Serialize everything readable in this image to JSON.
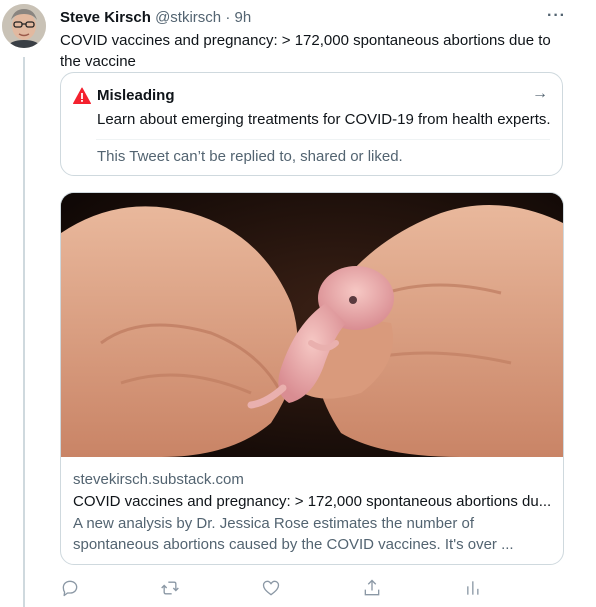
{
  "tweet": {
    "author_name": "Steve Kirsch",
    "author_handle": "@stkirsch",
    "separator": "·",
    "time": "9h",
    "more_icon": "more-horizontal-icon",
    "more_glyph": "···",
    "text": "COVID vaccines and pregnancy: > 172,000 spontaneous abortions due to the vaccine"
  },
  "notice": {
    "icon": "warning-icon",
    "title": "Misleading",
    "arrow_glyph": "→",
    "description": "Learn about emerging treatments for COVID-19 from health experts.",
    "restriction": "This Tweet can’t be replied to, shared or liked."
  },
  "link_card": {
    "domain": "stevekirsch.substack.com",
    "title": "COVID vaccines and pregnancy: > 172,000 spontaneous abortions du...",
    "description": "A new analysis by Dr. Jessica Rose estimates the number of spontaneous abortions caused by the COVID vaccines. It's over ..."
  },
  "actions": {
    "icons": [
      "reply-icon",
      "retweet-icon",
      "like-icon",
      "share-icon",
      "analytics-icon"
    ]
  },
  "colors": {
    "text_primary": "#0f1419",
    "text_secondary": "#536471",
    "border": "#cfd9de",
    "warning_red": "#f4212e"
  }
}
